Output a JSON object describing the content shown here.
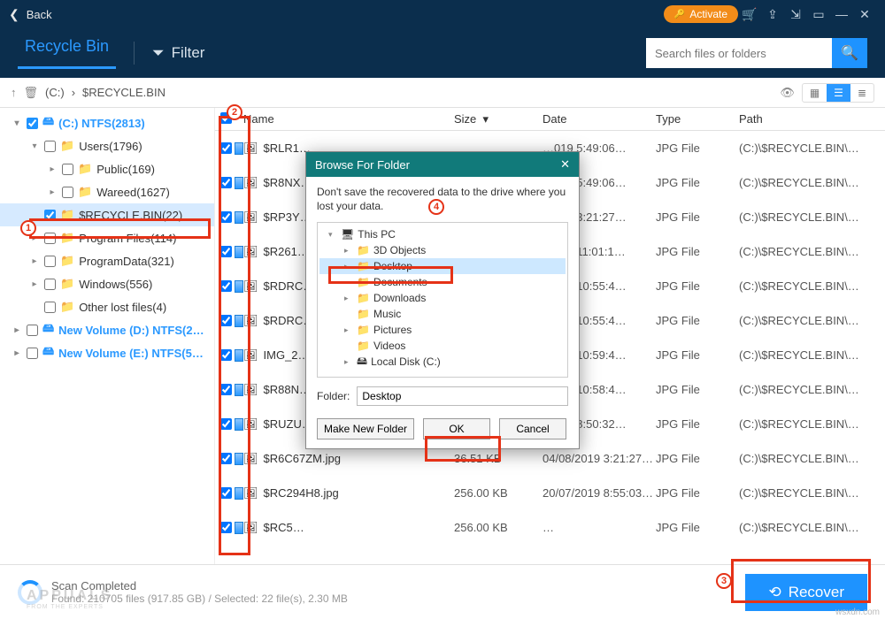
{
  "titlebar": {
    "back": "Back",
    "activate": "Activate"
  },
  "header": {
    "tab": "Recycle Bin",
    "filter": "Filter",
    "search_placeholder": "Search files or folders"
  },
  "breadcrumb": {
    "drive": "(C:)",
    "folder": "$RECYCLE.BIN"
  },
  "tree": [
    {
      "indent": 0,
      "arrow": "▾",
      "checked": true,
      "icon": "disk",
      "label": "(C:) NTFS(2813)",
      "bold": true
    },
    {
      "indent": 1,
      "arrow": "▾",
      "checked": false,
      "icon": "folder",
      "label": "Users(1796)"
    },
    {
      "indent": 2,
      "arrow": "▸",
      "checked": false,
      "icon": "folder",
      "label": "Public(169)"
    },
    {
      "indent": 2,
      "arrow": "▸",
      "checked": false,
      "icon": "folder",
      "label": "Wareed(1627)"
    },
    {
      "indent": 1,
      "arrow": "",
      "checked": true,
      "icon": "folder",
      "label": "$RECYCLE.BIN(22)",
      "selected": true
    },
    {
      "indent": 1,
      "arrow": "▸",
      "checked": false,
      "icon": "folder",
      "label": "Program Files(114)"
    },
    {
      "indent": 1,
      "arrow": "▸",
      "checked": false,
      "icon": "folder",
      "label": "ProgramData(321)"
    },
    {
      "indent": 1,
      "arrow": "▸",
      "checked": false,
      "icon": "folder",
      "label": "Windows(556)"
    },
    {
      "indent": 1,
      "arrow": "",
      "checked": false,
      "icon": "folder",
      "label": "Other lost files(4)"
    },
    {
      "indent": 0,
      "arrow": "▸",
      "checked": false,
      "icon": "disk",
      "label": "New Volume (D:) NTFS(2…",
      "bold": true
    },
    {
      "indent": 0,
      "arrow": "▸",
      "checked": false,
      "icon": "disk",
      "label": "New Volume (E:) NTFS(5…",
      "bold": true
    }
  ],
  "columns": {
    "name": "Name",
    "size": "Size",
    "date": "Date",
    "type": "Type",
    "path": "Path"
  },
  "files": [
    {
      "name": "$RLR1…",
      "size": "",
      "date": "…019 5:49:06…",
      "type": "JPG File",
      "path": "(C:)\\$RECYCLE.BIN\\…"
    },
    {
      "name": "$R8NX…",
      "size": "",
      "date": "…019 5:49:06…",
      "type": "JPG File",
      "path": "(C:)\\$RECYCLE.BIN\\…"
    },
    {
      "name": "$RP3Y…",
      "size": "",
      "date": "…019 3:21:27…",
      "type": "JPG File",
      "path": "(C:)\\$RECYCLE.BIN\\…"
    },
    {
      "name": "$R261…",
      "size": "",
      "date": "…019 11:01:1…",
      "type": "JPG File",
      "path": "(C:)\\$RECYCLE.BIN\\…"
    },
    {
      "name": "$RDRC…",
      "size": "",
      "date": "…019 10:55:4…",
      "type": "JPG File",
      "path": "(C:)\\$RECYCLE.BIN\\…"
    },
    {
      "name": "$RDRC…",
      "size": "",
      "date": "…019 10:55:4…",
      "type": "JPG File",
      "path": "(C:)\\$RECYCLE.BIN\\…"
    },
    {
      "name": "IMG_2…",
      "size": "",
      "date": "…019 10:59:4…",
      "type": "JPG File",
      "path": "(C:)\\$RECYCLE.BIN\\…"
    },
    {
      "name": "$R88N…",
      "size": "",
      "date": "…019 10:58:4…",
      "type": "JPG File",
      "path": "(C:)\\$RECYCLE.BIN\\…"
    },
    {
      "name": "$RUZU…",
      "size": "",
      "date": "…019 8:50:32…",
      "type": "JPG File",
      "path": "(C:)\\$RECYCLE.BIN\\…"
    },
    {
      "name": "$R6C67ZM.jpg",
      "size": "36.51 KB",
      "date": "04/08/2019 3:21:27…",
      "type": "JPG File",
      "path": "(C:)\\$RECYCLE.BIN\\…"
    },
    {
      "name": "$RC294H8.jpg",
      "size": "256.00 KB",
      "date": "20/07/2019 8:55:03…",
      "type": "JPG File",
      "path": "(C:)\\$RECYCLE.BIN\\…"
    },
    {
      "name": "$RC5…",
      "size": "256.00 KB",
      "date": "…",
      "type": "JPG File",
      "path": "(C:)\\$RECYCLE.BIN\\…"
    }
  ],
  "status": {
    "title": "Scan Completed",
    "detail": "Found: 210705 files (917.85 GB) / Selected: 22 file(s), 2.30 MB",
    "recover": "Recover"
  },
  "dialog": {
    "title": "Browse For Folder",
    "hint": "Don't save the recovered data to the drive where you lost your data.",
    "items": [
      {
        "indent": 0,
        "arrow": "▾",
        "icon": "pc",
        "label": "This PC"
      },
      {
        "indent": 1,
        "arrow": "▸",
        "icon": "f",
        "label": "3D Objects"
      },
      {
        "indent": 1,
        "arrow": "▸",
        "icon": "f",
        "label": "Desktop",
        "sel": true
      },
      {
        "indent": 1,
        "arrow": "",
        "icon": "f",
        "label": "Documents"
      },
      {
        "indent": 1,
        "arrow": "▸",
        "icon": "f",
        "label": "Downloads"
      },
      {
        "indent": 1,
        "arrow": "",
        "icon": "f",
        "label": "Music"
      },
      {
        "indent": 1,
        "arrow": "▸",
        "icon": "f",
        "label": "Pictures"
      },
      {
        "indent": 1,
        "arrow": "",
        "icon": "f",
        "label": "Videos"
      },
      {
        "indent": 1,
        "arrow": "▸",
        "icon": "disk",
        "label": "Local Disk (C:)"
      }
    ],
    "folder_label": "Folder:",
    "folder_value": "Desktop",
    "make": "Make New Folder",
    "ok": "OK",
    "cancel": "Cancel"
  },
  "watermark": {
    "brand": "APPUALS",
    "tag": "FROM THE EXPERTS",
    "site": "wsxdn.com"
  },
  "colors": {
    "accent": "#1e93ff",
    "orange": "#f28c19",
    "teal": "#117a7a"
  }
}
